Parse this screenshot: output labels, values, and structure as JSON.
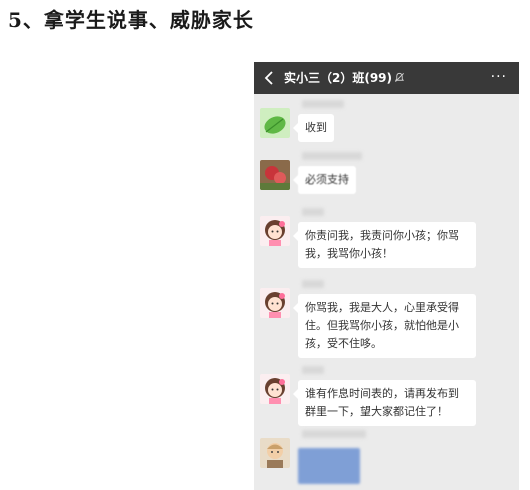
{
  "heading": "5、拿学生说事、威胁家长",
  "chat": {
    "title": "实小三（2）班(99)",
    "more_label": "···"
  },
  "messages": [
    {
      "avatar": "green-leaf-avatar-icon",
      "text": "收到"
    },
    {
      "avatar": "red-flower-avatar-icon",
      "text": "必须支持"
    },
    {
      "avatar": "cartoon-girl-avatar-icon",
      "text": "你责问我，我责问你小孩；你骂我，我骂你小孩！"
    },
    {
      "avatar": "cartoon-girl-avatar-icon",
      "text": "你骂我，我是大人，心里承受得住。但我骂你小孩，就怕他是小孩，受不住哆。"
    },
    {
      "avatar": "cartoon-girl-avatar-icon",
      "text": "谁有作息时间表的，请再发布到群里一下，望大家都记住了！"
    },
    {
      "avatar": "child-photo-avatar-icon",
      "text": ""
    }
  ],
  "colors": {
    "title_bar": "#393939",
    "chat_background": "#ebebeb",
    "bubble": "#ffffff"
  }
}
